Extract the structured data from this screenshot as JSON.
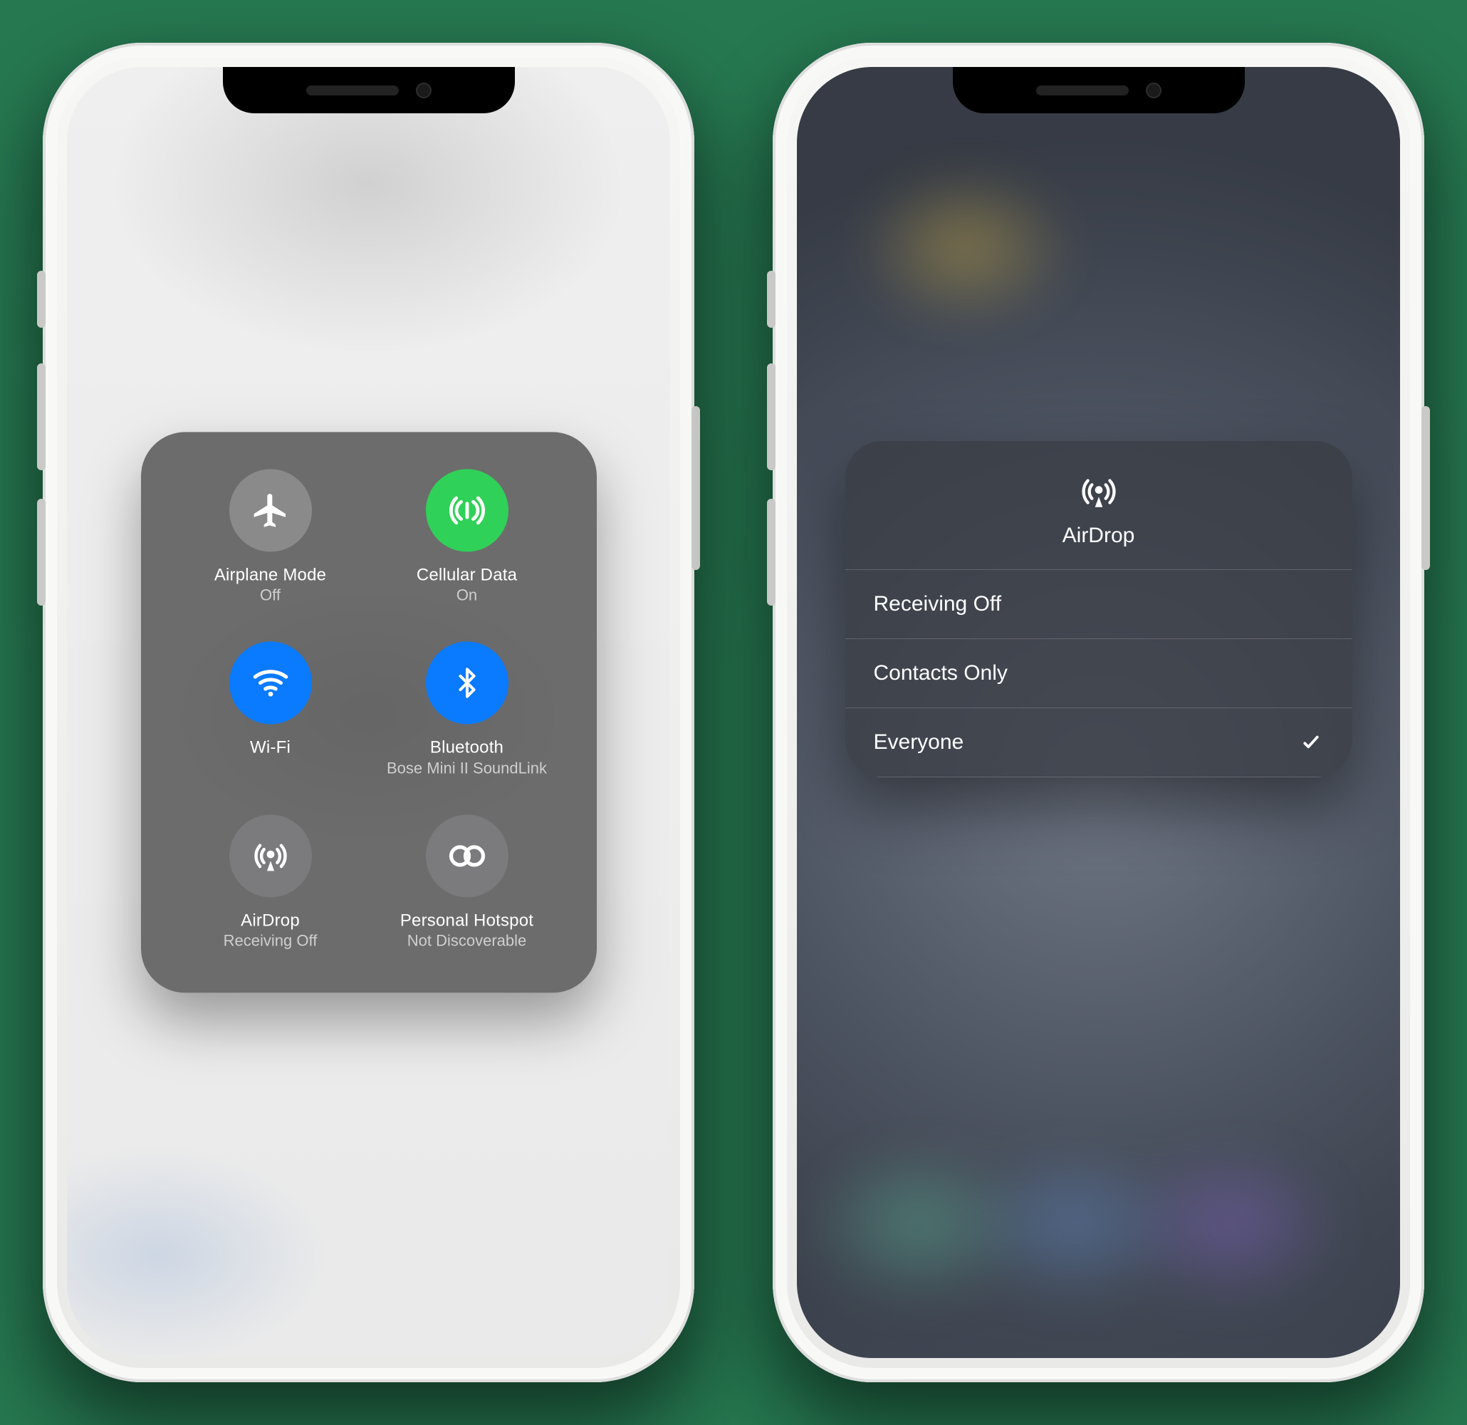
{
  "left": {
    "tiles": [
      {
        "id": "airplane",
        "title": "Airplane Mode",
        "sub": "Off",
        "color": "grey",
        "icon": "airplane-icon"
      },
      {
        "id": "cellular",
        "title": "Cellular Data",
        "sub": "On",
        "color": "green",
        "icon": "cellular-icon"
      },
      {
        "id": "wifi",
        "title": "Wi-Fi",
        "sub": "",
        "color": "blue",
        "icon": "wifi-icon"
      },
      {
        "id": "bluetooth",
        "title": "Bluetooth",
        "sub": "Bose Mini II SoundLink",
        "color": "blue",
        "icon": "bluetooth-icon"
      },
      {
        "id": "airdrop",
        "title": "AirDrop",
        "sub": "Receiving Off",
        "color": "grey2",
        "icon": "airdrop-icon"
      },
      {
        "id": "hotspot",
        "title": "Personal Hotspot",
        "sub": "Not Discoverable",
        "color": "grey2",
        "icon": "hotspot-icon"
      }
    ]
  },
  "right": {
    "popover": {
      "title": "AirDrop",
      "options": [
        {
          "label": "Receiving Off",
          "selected": false
        },
        {
          "label": "Contacts Only",
          "selected": false
        },
        {
          "label": "Everyone",
          "selected": true
        }
      ]
    }
  }
}
